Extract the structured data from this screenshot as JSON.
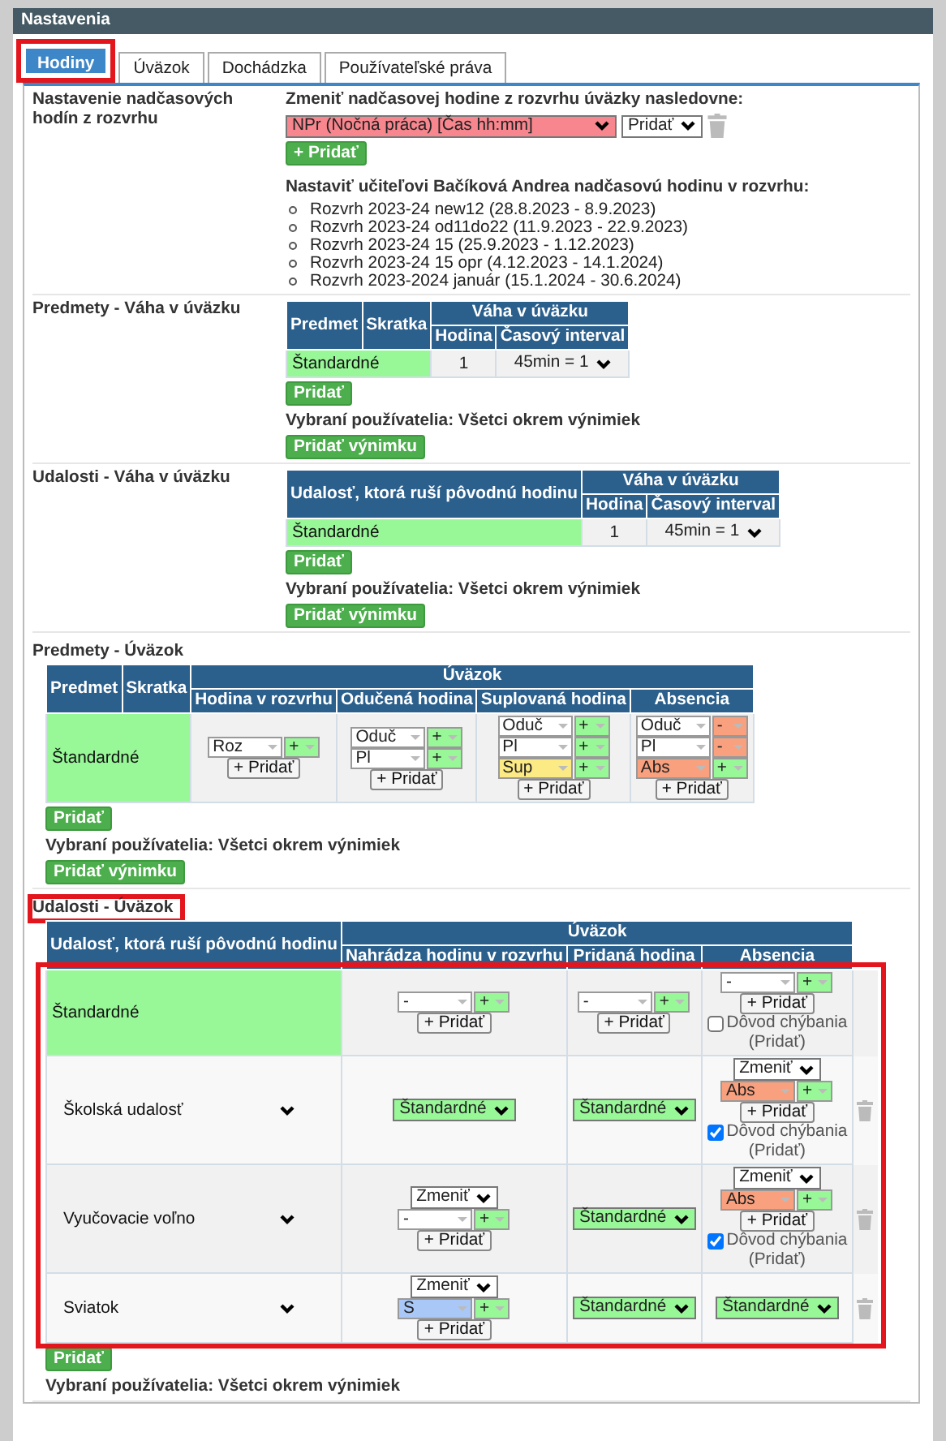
{
  "window": {
    "title": "Nastavenia"
  },
  "tabs": [
    {
      "label": "Hodiny",
      "selected": true,
      "highlighted": true
    },
    {
      "label": "Úväzok",
      "selected": false,
      "highlighted": false
    },
    {
      "label": "Dochádzka",
      "selected": false,
      "highlighted": false
    },
    {
      "label": "Používateľské práva",
      "selected": false,
      "highlighted": false
    }
  ],
  "sections": [
    {
      "kind": "overtime",
      "title": "Nastavenie nadčasových hodín z rozvrhu",
      "highlighted": false,
      "prompt": "Zmeniť nadčasovej hodine z rozvrhu úväzky nasledovne:",
      "select": {
        "value": "NPr (Nočná práca) [Čas hh:mm]",
        "color": "#f7868e"
      },
      "action": "Pridať",
      "add_button": "+ Pridať",
      "schedule_heading": "Nastaviť učiteľovi Bačíková Andrea nadčasovú hodinu v rozvrhu:",
      "schedules": [
        "Rozvrh 2023-24 new12 (28.8.2023 - 8.9.2023)",
        "Rozvrh 2023-24 od11do22 (11.9.2023 - 22.9.2023)",
        "Rozvrh 2023-24 15 (25.9.2023 - 1.12.2023)",
        "Rozvrh 2023-24 15 opr (4.12.2023 - 14.1.2024)",
        "Rozvrh 2023-2024 január (15.1.2024 - 30.6.2024)"
      ]
    },
    {
      "kind": "weight",
      "title": "Predmety - Váha v úväzku",
      "highlighted": false,
      "table": {
        "columns": [
          "Predmet",
          "Skratka"
        ],
        "group": "Váha v úväzku",
        "sub_columns": [
          "Hodina",
          "Časový interval"
        ],
        "rows": [
          {
            "name": "Štandardné",
            "color": "#98f898",
            "dropdown": false,
            "cells": [
              [
                {
                  "kind": "text",
                  "text": "1"
                }
              ],
              [
                {
                  "kind": "plain_select",
                  "value": "45min = 1"
                }
              ]
            ]
          }
        ]
      },
      "add_button": "Pridať",
      "users": "Vybraní používatelia: Všetci okrem výnimiek",
      "exception_button": "Pridať výnimku"
    },
    {
      "kind": "weight",
      "title": "Udalosti - Váha v úväzku",
      "highlighted": false,
      "table": {
        "columns": [
          "Udalosť, ktorá ruší pôvodnú hodinu"
        ],
        "group": "Váha v úväzku",
        "sub_columns": [
          "Hodina",
          "Časový interval"
        ],
        "rows": [
          {
            "name": "Štandardné",
            "color": "#98f898",
            "dropdown": false,
            "cells": [
              [
                {
                  "kind": "text",
                  "text": "1"
                }
              ],
              [
                {
                  "kind": "plain_select",
                  "value": "45min = 1"
                }
              ]
            ]
          }
        ]
      },
      "add_button": "Pridať",
      "users": "Vybraní používatelia: Všetci okrem výnimiek",
      "exception_button": "Pridať výnimku"
    },
    {
      "kind": "load",
      "title": "Predmety - Úväzok",
      "highlighted": false,
      "table": {
        "columns": [
          "Predmet",
          "Skratka"
        ],
        "group": "Úväzok",
        "sub_columns": [
          "Hodina v rozvrhu",
          "Odučená hodina",
          "Suplovaná hodina",
          "Absencia"
        ],
        "rows": [
          {
            "name": "Štandardné",
            "color": "#98f898",
            "dropdown": false,
            "cells": [
              [
                {
                  "kind": "combo",
                  "value": "Roz",
                  "color": "#ffffff",
                  "sign": {
                    "label": "+",
                    "color": "#98f898"
                  }
                },
                {
                  "kind": "add",
                  "label": "+ Pridať"
                }
              ],
              [
                {
                  "kind": "combo",
                  "value": "Oduč",
                  "color": "#ffffff",
                  "sign": {
                    "label": "+",
                    "color": "#98f898"
                  }
                },
                {
                  "kind": "combo",
                  "value": "Pl",
                  "color": "#ffffff",
                  "sign": {
                    "label": "+",
                    "color": "#98f898"
                  }
                },
                {
                  "kind": "add",
                  "label": "+ Pridať"
                }
              ],
              [
                {
                  "kind": "combo",
                  "value": "Oduč",
                  "color": "#ffffff",
                  "sign": {
                    "label": "+",
                    "color": "#98f898"
                  }
                },
                {
                  "kind": "combo",
                  "value": "Pl",
                  "color": "#ffffff",
                  "sign": {
                    "label": "+",
                    "color": "#98f898"
                  }
                },
                {
                  "kind": "combo",
                  "value": "Sup",
                  "color": "#fcea84",
                  "sign": {
                    "label": "+",
                    "color": "#98f898"
                  }
                },
                {
                  "kind": "add",
                  "label": "+ Pridať"
                }
              ],
              [
                {
                  "kind": "combo",
                  "value": "Oduč",
                  "color": "#ffffff",
                  "sign": {
                    "label": "-",
                    "color": "#f9a07e"
                  }
                },
                {
                  "kind": "combo",
                  "value": "Pl",
                  "color": "#ffffff",
                  "sign": {
                    "label": "-",
                    "color": "#f9a07e"
                  }
                },
                {
                  "kind": "combo",
                  "value": "Abs",
                  "color": "#f9a07e",
                  "sign": {
                    "label": "+",
                    "color": "#98f898"
                  }
                },
                {
                  "kind": "add",
                  "label": "+ Pridať"
                }
              ]
            ]
          }
        ]
      },
      "add_button": "Pridať",
      "users": "Vybraní používatelia: Všetci okrem výnimiek",
      "exception_button": "Pridať výnimku"
    },
    {
      "kind": "load",
      "title": "Udalosti - Úväzok",
      "highlighted": true,
      "table": {
        "body_highlighted": true,
        "columns": [
          "Udalosť, ktorá ruší pôvodnú hodinu"
        ],
        "group": "Úväzok",
        "sub_columns": [
          "Nahrádza hodinu v rozvrhu",
          "Pridaná hodina",
          "Absencia"
        ],
        "rows": [
          {
            "name": "Štandardné",
            "color": "#98f898",
            "dropdown": false,
            "cells": [
              [
                {
                  "kind": "combo",
                  "value": "-",
                  "color": "#ffffff",
                  "sign": {
                    "label": "+",
                    "color": "#98f898"
                  }
                },
                {
                  "kind": "add",
                  "label": "+ Pridať"
                }
              ],
              [
                {
                  "kind": "combo",
                  "value": "-",
                  "color": "#ffffff",
                  "sign": {
                    "label": "+",
                    "color": "#98f898"
                  }
                },
                {
                  "kind": "add",
                  "label": "+ Pridať"
                }
              ],
              [
                {
                  "kind": "combo",
                  "value": "-",
                  "color": "#ffffff",
                  "sign": {
                    "label": "+",
                    "color": "#98f898"
                  }
                },
                {
                  "kind": "add",
                  "label": "+ Pridať"
                },
                {
                  "kind": "checkbox",
                  "label": "Dôvod chýbania",
                  "checked": false
                },
                {
                  "kind": "note",
                  "text": "(Pridať)"
                }
              ]
            ]
          },
          {
            "name": "Školská udalosť",
            "dropdown": true,
            "deletable": true,
            "cells": [
              [
                {
                  "kind": "select",
                  "value": "Štandardné",
                  "color": "#98f898"
                }
              ],
              [
                {
                  "kind": "select",
                  "value": "Štandardné",
                  "color": "#98f898"
                }
              ],
              [
                {
                  "kind": "select",
                  "value": "Zmeniť",
                  "color": "#ffffff"
                },
                {
                  "kind": "combo",
                  "value": "Abs",
                  "color": "#f9a07e",
                  "sign": {
                    "label": "+",
                    "color": "#98f898"
                  }
                },
                {
                  "kind": "add",
                  "label": "+ Pridať"
                },
                {
                  "kind": "checkbox",
                  "label": "Dôvod chýbania",
                  "checked": true
                },
                {
                  "kind": "note",
                  "text": "(Pridať)"
                }
              ]
            ]
          },
          {
            "name": "Vyučovacie voľno",
            "dropdown": true,
            "deletable": true,
            "cells": [
              [
                {
                  "kind": "select",
                  "value": "Zmeniť",
                  "color": "#ffffff"
                },
                {
                  "kind": "combo",
                  "value": "-",
                  "color": "#ffffff",
                  "sign": {
                    "label": "+",
                    "color": "#98f898"
                  }
                },
                {
                  "kind": "add",
                  "label": "+ Pridať"
                }
              ],
              [
                {
                  "kind": "select",
                  "value": "Štandardné",
                  "color": "#98f898"
                }
              ],
              [
                {
                  "kind": "select",
                  "value": "Zmeniť",
                  "color": "#ffffff"
                },
                {
                  "kind": "combo",
                  "value": "Abs",
                  "color": "#f9a07e",
                  "sign": {
                    "label": "+",
                    "color": "#98f898"
                  }
                },
                {
                  "kind": "add",
                  "label": "+ Pridať"
                },
                {
                  "kind": "checkbox",
                  "label": "Dôvod chýbania",
                  "checked": true
                },
                {
                  "kind": "note",
                  "text": "(Pridať)"
                }
              ]
            ]
          },
          {
            "name": "Sviatok",
            "dropdown": true,
            "deletable": true,
            "cells": [
              [
                {
                  "kind": "select",
                  "value": "Zmeniť",
                  "color": "#ffffff"
                },
                {
                  "kind": "combo",
                  "value": "S",
                  "color": "#a9c8f7",
                  "sign": {
                    "label": "+",
                    "color": "#98f898"
                  }
                },
                {
                  "kind": "add",
                  "label": "+ Pridať"
                }
              ],
              [
                {
                  "kind": "select",
                  "value": "Štandardné",
                  "color": "#98f898"
                }
              ],
              [
                {
                  "kind": "select",
                  "value": "Štandardné",
                  "color": "#98f898"
                }
              ]
            ]
          }
        ]
      },
      "add_button": "Pridať",
      "users": "Vybraní používatelia: Všetci okrem výnimiek"
    }
  ]
}
